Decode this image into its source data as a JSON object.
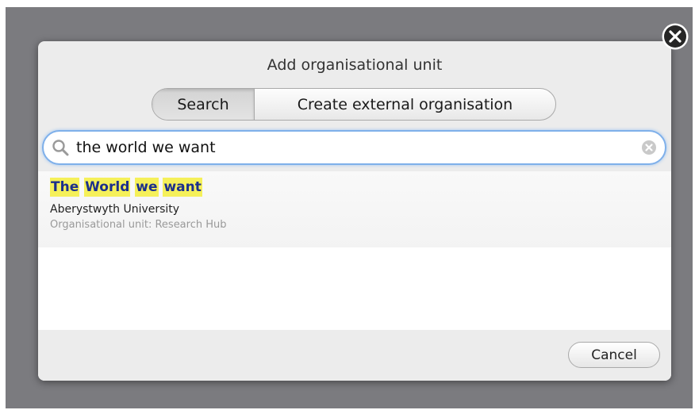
{
  "dialog": {
    "title": "Add organisational unit",
    "tabs": [
      {
        "label": "Search",
        "active": true
      },
      {
        "label": "Create external organisation",
        "active": false
      }
    ],
    "search": {
      "value": "the world we want",
      "placeholder": ""
    },
    "results": [
      {
        "title_words": [
          "The",
          "World",
          "we",
          "want"
        ],
        "organisation": "Aberystwyth University",
        "meta": "Organisational unit: Research Hub"
      }
    ],
    "cancel_label": "Cancel"
  },
  "colors": {
    "highlight": "#f5f05a",
    "result_title": "#1c2f8c",
    "focus_ring": "#7fb0ea"
  },
  "icons": [
    "close-icon",
    "search-icon",
    "clear-icon"
  ]
}
